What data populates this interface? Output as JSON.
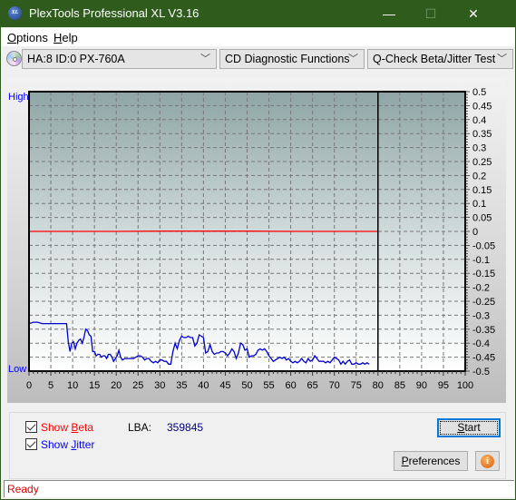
{
  "window": {
    "title": "PlexTools Professional XL V3.16",
    "logo_text": "XL",
    "minimize_glyph": "—",
    "maximize_glyph": "☐",
    "close_glyph": "✕"
  },
  "menu": [
    {
      "label": "Options",
      "mnemonic": "O"
    },
    {
      "label": "Help",
      "mnemonic": "H"
    }
  ],
  "toolbar": {
    "drive_icon": "cd-disc-icon",
    "drive": "HA:8 ID:0  PX-760A",
    "function": "CD Diagnostic Functions",
    "test": "Q-Check Beta/Jitter Test",
    "dropdown_glyph": "﹀"
  },
  "chart_data": {
    "type": "line",
    "title": "",
    "left_axis": {
      "top_label": "High",
      "bottom_label": "Low"
    },
    "x_ticks": [
      "0",
      "5",
      "10",
      "15",
      "20",
      "25",
      "30",
      "35",
      "40",
      "45",
      "50",
      "55",
      "60",
      "65",
      "70",
      "75",
      "80",
      "85",
      "90",
      "95",
      "100"
    ],
    "xlim": [
      0,
      100
    ],
    "x_marker": 80,
    "y_ticks": [
      "0.5",
      "0.45",
      "0.4",
      "0.35",
      "0.3",
      "0.25",
      "0.2",
      "0.15",
      "0.1",
      "0.05",
      "0",
      "-0.05",
      "-0.1",
      "-0.15",
      "-0.2",
      "-0.25",
      "-0.3",
      "-0.35",
      "-0.4",
      "-0.45",
      "-0.5"
    ],
    "ylim": [
      -0.5,
      0.5
    ],
    "grid": true,
    "colors": {
      "beta": "#ff0000",
      "jitter": "#0000cc",
      "bg_top": "#8fa5a5",
      "bg_bottom": "#ffffff"
    },
    "series": [
      {
        "name": "Beta",
        "x": [
          0,
          10,
          20,
          30,
          40,
          50,
          60,
          70,
          80
        ],
        "y": [
          0.0,
          0.0,
          0.0,
          0.001,
          0.001,
          0.001,
          0.0,
          0.0,
          0.0
        ]
      },
      {
        "name": "Jitter",
        "x": [
          0,
          1,
          2,
          3,
          4,
          5,
          6,
          7,
          8,
          8.6,
          9,
          9.4,
          9.8,
          10.2,
          10.6,
          11,
          11.4,
          11.8,
          12.2,
          12.6,
          13,
          13.4,
          13.8,
          14.2,
          14.6,
          15,
          15.4,
          15.8,
          16.2,
          16.6,
          17,
          17.4,
          17.8,
          18.2,
          18.6,
          19,
          19.4,
          19.8,
          20.2,
          20.6,
          21,
          21.4,
          22,
          23,
          24,
          25,
          25.5,
          26,
          26.5,
          27,
          27.5,
          28,
          28.5,
          29,
          29.5,
          30,
          30.5,
          31,
          31.5,
          32,
          32.5,
          33,
          33.5,
          34,
          34.5,
          35,
          35.5,
          36,
          36.5,
          37,
          37.5,
          38,
          38.5,
          39,
          39.5,
          40,
          40.5,
          41,
          41.5,
          42,
          42.5,
          43,
          43.5,
          44,
          44.5,
          45,
          45.5,
          46,
          46.5,
          47,
          47.5,
          48,
          48.5,
          49,
          49.5,
          50,
          50.5,
          51,
          51.5,
          52,
          52.5,
          53,
          53.5,
          54,
          54.5,
          55,
          55.5,
          56,
          56.5,
          57,
          57.5,
          58,
          58.5,
          59,
          59.5,
          60,
          60.5,
          61,
          61.5,
          62,
          62.5,
          63,
          63.5,
          64,
          64.5,
          65,
          65.5,
          66,
          66.5,
          67,
          67.5,
          68,
          68.5,
          69,
          69.5,
          70,
          70.5,
          71,
          71.5,
          72,
          72.5,
          73,
          73.5,
          74,
          74.5,
          75,
          75.5,
          76,
          76.5,
          77,
          77.5,
          78,
          78.5,
          79,
          79.5
        ],
        "y": [
          -0.33,
          -0.325,
          -0.325,
          -0.33,
          -0.33,
          -0.33,
          -0.33,
          -0.33,
          -0.33,
          -0.33,
          -0.395,
          -0.43,
          -0.4,
          -0.395,
          -0.42,
          -0.4,
          -0.39,
          -0.385,
          -0.4,
          -0.38,
          -0.35,
          -0.355,
          -0.37,
          -0.375,
          -0.43,
          -0.43,
          -0.445,
          -0.44,
          -0.44,
          -0.45,
          -0.445,
          -0.445,
          -0.455,
          -0.44,
          -0.44,
          -0.45,
          -0.465,
          -0.455,
          -0.445,
          -0.425,
          -0.45,
          -0.46,
          -0.455,
          -0.455,
          -0.455,
          -0.445,
          -0.445,
          -0.45,
          -0.46,
          -0.455,
          -0.455,
          -0.465,
          -0.47,
          -0.465,
          -0.47,
          -0.46,
          -0.46,
          -0.465,
          -0.465,
          -0.475,
          -0.475,
          -0.43,
          -0.4,
          -0.42,
          -0.39,
          -0.375,
          -0.38,
          -0.38,
          -0.375,
          -0.38,
          -0.38,
          -0.41,
          -0.4,
          -0.37,
          -0.375,
          -0.38,
          -0.435,
          -0.43,
          -0.405,
          -0.43,
          -0.44,
          -0.435,
          -0.435,
          -0.43,
          -0.43,
          -0.435,
          -0.445,
          -0.435,
          -0.42,
          -0.43,
          -0.455,
          -0.435,
          -0.4,
          -0.405,
          -0.425,
          -0.42,
          -0.45,
          -0.445,
          -0.445,
          -0.44,
          -0.425,
          -0.42,
          -0.425,
          -0.42,
          -0.43,
          -0.445,
          -0.455,
          -0.465,
          -0.46,
          -0.455,
          -0.45,
          -0.455,
          -0.45,
          -0.46,
          -0.455,
          -0.465,
          -0.47,
          -0.465,
          -0.47,
          -0.465,
          -0.455,
          -0.465,
          -0.47,
          -0.455,
          -0.465,
          -0.46,
          -0.445,
          -0.455,
          -0.465,
          -0.465,
          -0.465,
          -0.47,
          -0.465,
          -0.47,
          -0.46,
          -0.45,
          -0.455,
          -0.46,
          -0.475,
          -0.465,
          -0.475,
          -0.465,
          -0.46,
          -0.475,
          -0.475,
          -0.47,
          -0.475,
          -0.475,
          -0.47,
          -0.475,
          -0.47,
          -0.475
        ]
      }
    ]
  },
  "controls": {
    "show_beta": {
      "label_pre": "Show ",
      "mnemonic": "B",
      "label_post": "eta",
      "checked": true
    },
    "show_jitter": {
      "label_pre": "Show ",
      "mnemonic": "J",
      "label_post": "itter",
      "checked": true
    },
    "lba_label": "LBA:",
    "lba_value": "359845",
    "start_mnemonic": "S",
    "start_rest": "tart",
    "pref_mnemonic": "P",
    "pref_rest": "references",
    "info_glyph": "i"
  },
  "status": {
    "text": "Ready"
  }
}
